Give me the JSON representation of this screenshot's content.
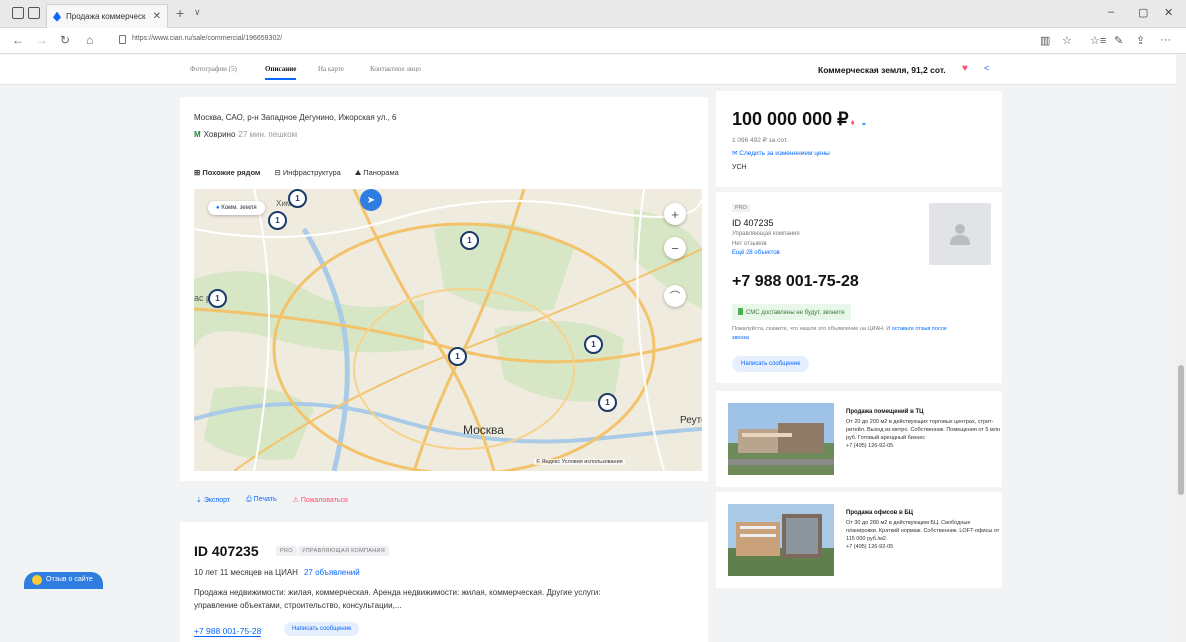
{
  "browser": {
    "tab_title": "Продажа коммерческ",
    "tab_close": "✕",
    "new_tab": "+",
    "tab_dropdown": "∨",
    "url": "https://www.cian.ru/sale/commercial/196659302/",
    "back": "←",
    "forward": "→",
    "refresh": "↻",
    "home": "⌂",
    "minimize": "–",
    "maximize": "▢",
    "close": "✕",
    "reading_view": "▥",
    "favorite": "☆",
    "favorites_bar": "☆≡",
    "pen": "✎",
    "share": "⇪",
    "more": "···"
  },
  "subnav": {
    "tabs": [
      "Фотографии (5)",
      "Описание",
      "На карте",
      "Контактное лицо"
    ],
    "object_title": "Коммерческая земля, 91,2 сот.",
    "heart": "♥",
    "share": "<"
  },
  "listing": {
    "address": "Москва, САО, р-н Западное Дегунино, Ижорская ул., 6",
    "metro_symbol": "М",
    "metro_station": "Ховрино",
    "metro_distance": "27 мин. пешком",
    "map_tabs": [
      "Похожие рядом",
      "Инфраструктура",
      "Панорама"
    ],
    "map_tab_icons": [
      "⊞",
      "⊟",
      "⛰"
    ],
    "map_chip": "Комм. земля",
    "map_labels": [
      "Химки",
      "Москва",
      "Реутов",
      "Красногорск"
    ],
    "map_labels_short": {
      "himki": "Химки",
      "moscow": "Москва",
      "reutov": "Реутов",
      "krasn": "ас  рск"
    },
    "pins": [
      "1",
      "1",
      "1",
      "1",
      "1",
      "1",
      "1"
    ],
    "zoom_in": "+",
    "zoom_out": "−",
    "ruler": "⌒",
    "attribution": "© Яндекс Условия использования",
    "actions": [
      "Экспорт",
      "Печать",
      "Пожаловаться"
    ]
  },
  "agency": {
    "id": "ID 407235",
    "badge_pro": "PRO",
    "badge_type": "УПРАВЛЯЮЩАЯ КОМПАНИЯ",
    "years": "10 лет 11 месяцев на ЦИАН",
    "listings": "27 объявлений",
    "description": "Продажа недвижимости: жилая, коммерческая. Аренда недвижимости: жилая, коммерческая. Другие услуги: управление объектами, строительство, консультации,...",
    "phone": "+7 988 001-75-28",
    "write": "Написать сообщение"
  },
  "price_card": {
    "price": "100 000 000 ₽",
    "drop_icon": "♦",
    "chevron": "⌄",
    "per_unit": "1 096 492 ₽ за сот.",
    "watch": "Следить за изменением цены",
    "tax": "УСН"
  },
  "seller": {
    "pro": "PRO",
    "id": "ID 407235",
    "type": "Управляющая компания",
    "reviews": "Нет отзывов",
    "more": "Ещё 28 объектов",
    "phone": "+7 988 001-75-28",
    "sms": "СМС доставлены не будут, звоните",
    "note": "Пожалуйста, скажите, что нашли это объявление на ЦИАН. И ",
    "note_link": "оставьте отзыв после звонка",
    "write": "Написать сообщение"
  },
  "ads": [
    {
      "title": "Продажа помещений в ТЦ",
      "text": "От 20 до 200 м2 в действующих торговых центрах, стрит-ритейл. Выход из метро. Собственник. Помещения от 5 млн руб. Готовый арендный бизнес",
      "phone": "+7 (495) 126-92-05"
    },
    {
      "title": "Продажа офисов в БЦ",
      "text": "От 30 до 280 м2 в действующем БЦ. Свободные планировки. Краткий нормаж. Собственник. LOFT-офисы от 115 000 руб./м2.",
      "phone": "+7 (495) 126-92-05"
    }
  ],
  "feedback": "Отзыв о сайте",
  "colors": {
    "accent": "#0468ff",
    "price_drop": "#ff4d6d",
    "metro": "#1a8a3c",
    "map_bg": "#efe9dd"
  }
}
